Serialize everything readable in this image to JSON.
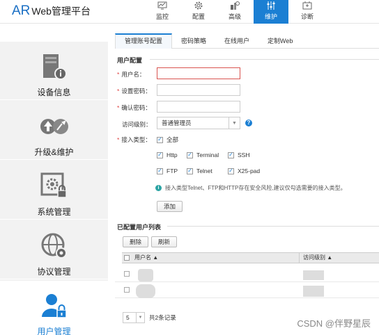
{
  "header": {
    "brand_ar": "AR",
    "brand_rest": "Web管理平台",
    "nav": [
      {
        "label": "监控",
        "icon": "monitor-icon"
      },
      {
        "label": "配置",
        "icon": "gear-icon"
      },
      {
        "label": "高级",
        "icon": "advanced-icon"
      },
      {
        "label": "维护",
        "icon": "maintenance-icon",
        "active": true
      },
      {
        "label": "诊断",
        "icon": "diagnose-icon"
      }
    ]
  },
  "sidebar": {
    "items": [
      {
        "label": "设备信息",
        "icon": "device-info-icon"
      },
      {
        "label": "升级&维护",
        "icon": "upgrade-icon"
      },
      {
        "label": "系统管理",
        "icon": "system-manage-icon"
      },
      {
        "label": "协议管理",
        "icon": "protocol-manage-icon"
      },
      {
        "label": "用户管理",
        "icon": "user-manage-icon",
        "active": true
      }
    ]
  },
  "tabs": [
    "管理账号配置",
    "密码策略",
    "在线用户",
    "定制Web"
  ],
  "form": {
    "section_title": "用户配置",
    "username_label": "用户名：",
    "password_label": "设置密码：",
    "confirm_label": "确认密码：",
    "access_level_label": "访问级别：",
    "access_level_value": "普通管理员",
    "access_type_label": "接入类型：",
    "select_all": "全部",
    "types": [
      "Http",
      "Terminal",
      "SSH",
      "FTP",
      "Telnet",
      "X25-pad"
    ],
    "info_text": "接入类型Telnet、FTP和HTTP存在安全风险,建议仅勾选需要的接入类型。",
    "add_button": "添加"
  },
  "list": {
    "section_title": "已配置用户列表",
    "delete_button": "删除",
    "refresh_button": "刷新",
    "columns": [
      "用户名",
      "访问级别"
    ],
    "rows": 2,
    "page_size": "5",
    "total_text": "共2条记录"
  },
  "watermark": "CSDN @伴野星辰",
  "colors": {
    "accent": "#1b7fd3",
    "error": "#d9534f",
    "required": "#e04040"
  }
}
